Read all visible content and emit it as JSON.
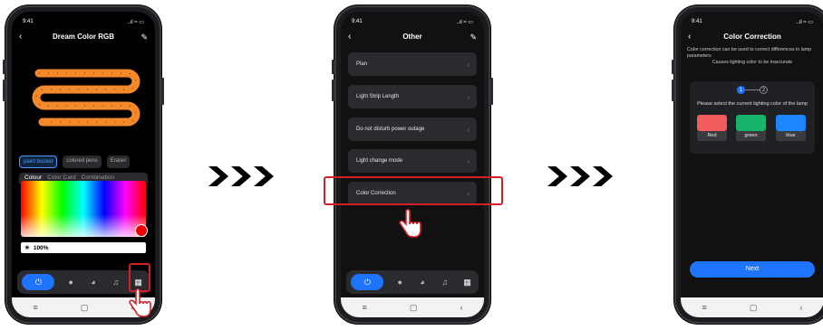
{
  "phone1": {
    "status": {
      "time": "9:41",
      "icons": "..ıl ≈ ▭"
    },
    "title": "Dream Color RGB",
    "tools": [
      "paint bucket",
      "colored pens",
      "Eraser"
    ],
    "tabs": [
      "Colour",
      "Color Card",
      "Combination"
    ],
    "brightness": "100%",
    "selected_color": "#e00000",
    "controls": [
      "power-icon",
      "bulb-icon",
      "palette-icon",
      "music-icon",
      "grid-icon"
    ]
  },
  "phone2": {
    "status": {
      "time": "9:41",
      "icons": "..ıl ≈ ▭"
    },
    "title": "Other",
    "items": [
      "Plan",
      "Light Strip Length",
      "Do not disturb power outage",
      "Light change mode",
      "Color Correction"
    ],
    "controls": [
      "power-icon",
      "bulb-icon",
      "palette-icon",
      "music-icon",
      "grid-icon"
    ]
  },
  "phone3": {
    "status": {
      "time": "9:41",
      "icons": "..ıl ≈ ▭"
    },
    "title": "Color Correction",
    "description": "Color correction can be used to correct differences in lamp parameters",
    "description2": "Causes lighting color to be inaccurate",
    "steps": [
      "1",
      "2"
    ],
    "prompt": "Please select the current lighting color of the lamp",
    "swatches": [
      {
        "label": "Red",
        "color": "#f25c5c"
      },
      {
        "label": "green",
        "color": "#17b36b"
      },
      {
        "label": "blue",
        "color": "#1e86ff"
      }
    ],
    "next_label": "Next"
  },
  "nav_icons": {
    "menu": "≡",
    "home": "▢",
    "back": "‹"
  },
  "glyphs": {
    "back": "‹",
    "edit": "✎",
    "chevron": "›",
    "power": "⏻",
    "bulb": "●",
    "palette": "◕",
    "music": "♫",
    "grid": "▦",
    "sun": "☀"
  },
  "colors": {
    "accent": "#1e74ff",
    "highlight": "#d31f26",
    "strip": "#f4892a"
  }
}
